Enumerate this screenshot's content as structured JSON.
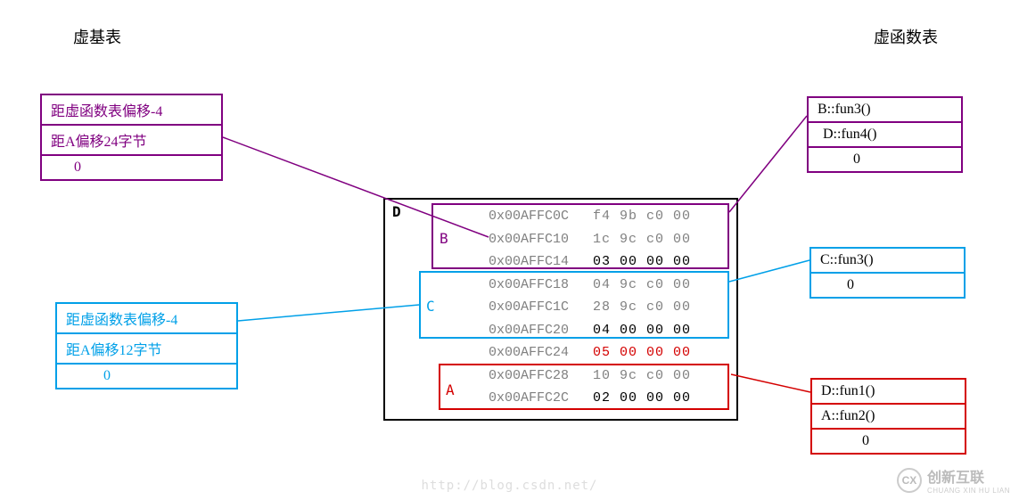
{
  "titles": {
    "left": "虚基表",
    "right": "虚函数表"
  },
  "vb_purple": {
    "r1": "距虚函数表偏移-4",
    "r2": "距A偏移24字节",
    "r3": "0"
  },
  "vb_blue": {
    "r1": "距虚函数表偏移-4",
    "r2": "距A偏移12字节",
    "r3": "0"
  },
  "vf_purple": {
    "r1": "B::fun3()",
    "r2": "D::fun4()",
    "r3": "0"
  },
  "vf_cyan": {
    "r1": "C::fun3()",
    "r2": "0"
  },
  "vf_red": {
    "r1": "D::fun1()",
    "r2": "A::fun2()",
    "r3": "0"
  },
  "mem": {
    "d_label": "D",
    "b_label": "B",
    "c_label": "C",
    "a_label": "A",
    "rows": [
      {
        "addr": "0x00AFFC0C",
        "bytes": "f4 9b c0 00",
        "color": "#808080"
      },
      {
        "addr": "0x00AFFC10",
        "bytes": "1c 9c c0 00",
        "color": "#808080"
      },
      {
        "addr": "0x00AFFC14",
        "bytes": "03 00 00 00",
        "color": "#000"
      },
      {
        "addr": "0x00AFFC18",
        "bytes": "04 9c c0 00",
        "color": "#808080"
      },
      {
        "addr": "0x00AFFC1C",
        "bytes": "28 9c c0 00",
        "color": "#808080"
      },
      {
        "addr": "0x00AFFC20",
        "bytes": "04 00 00 00",
        "color": "#000"
      },
      {
        "addr": "0x00AFFC24",
        "bytes": "05 00 00 00",
        "color": "#d40000"
      },
      {
        "addr": "0x00AFFC28",
        "bytes": "10 9c c0 00",
        "color": "#808080"
      },
      {
        "addr": "0x00AFFC2C",
        "bytes": "02 00 00 00",
        "color": "#000"
      }
    ]
  },
  "footer": {
    "url": "http://blog.csdn.net/",
    "brand": "创新互联",
    "brand_sub": "CHUANG XIN HU LIAN"
  }
}
